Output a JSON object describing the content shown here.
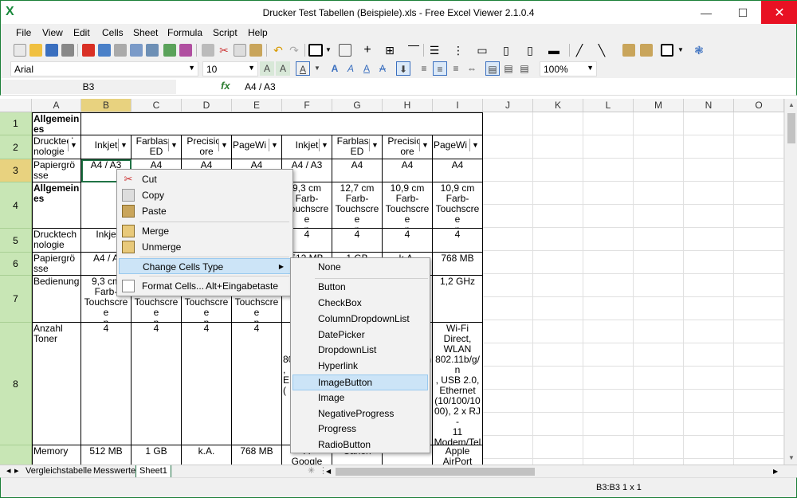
{
  "window": {
    "title": "Drucker Test Tabellen (Beispiele).xls - Free Excel Viewer 2.1.0.4",
    "app_icon": "X",
    "minimize": "—",
    "maximize": "☐",
    "close": "✕"
  },
  "menu": [
    "File",
    "View",
    "Edit",
    "Cells",
    "Sheet",
    "Formula",
    "Script",
    "Help"
  ],
  "toolbar": {
    "font": "Arial",
    "size": "10",
    "zoom": "100%"
  },
  "formula": {
    "name_box": "B3",
    "fx": "fx",
    "value": "A4 / A3"
  },
  "columns": [
    "A",
    "B",
    "C",
    "D",
    "E",
    "F",
    "G",
    "H",
    "I",
    "J",
    "K",
    "L",
    "M",
    "N",
    "O"
  ],
  "rows": [
    "1",
    "2",
    "3",
    "4",
    "5",
    "6",
    "7",
    "8",
    ""
  ],
  "cells": {
    "r1": {
      "a": "Allgemeines"
    },
    "r2": {
      "a": "Drucktechnologie",
      "b": "Inkjet",
      "c": "Farblaser\nED",
      "d": "Precision\nore",
      "e": "PageWi",
      "f": "Inkjet",
      "g": "Farblaser\nED",
      "h": "Precision\nore",
      "i": "PageWi"
    },
    "r3": {
      "a": "Papiergrösse",
      "b": "A4 / A3",
      "c": "A4",
      "d": "A4",
      "e": "A4",
      "f": "A4 / A3",
      "g": "A4",
      "h": "A4",
      "i": "A4"
    },
    "r4": {
      "a": "Allgemeines",
      "f": "9,3 cm\nFarb-\nTouchscree\nn",
      "g": "12,7 cm\nFarb-\nTouchscree\nn",
      "h": "10,9 cm\nFarb-\nTouchscree\nn",
      "i": "10,9 cm\nFarb-\nTouchscree\nn"
    },
    "r5": {
      "a": "Drucktechnologie",
      "b": "Inkje",
      "f": "4",
      "g": "4",
      "h": "4",
      "i": "4"
    },
    "r6": {
      "a": "Papiergrösse",
      "b": "A4 / A",
      "f": "512 MB",
      "g": "1 GB",
      "h": "k.A.",
      "i": "768 MB"
    },
    "r7": {
      "a": "Bedienung",
      "b": "9,3 cm\nFarb-\nTouchscree\nn",
      "c": "Farb-\nTouchscree\nn",
      "d": "Farb-\nTouchscree\nn",
      "e": "Farb-\nTouchscree\nn",
      "i": "1,2 GHz"
    },
    "r8": {
      "a": "Anzahl\nToner",
      "b": "4",
      "c": "4",
      "d": "4",
      "e": "4",
      "f": "80\n,\nE\n(",
      "h": "n",
      "i": "Wi-Fi\nDirect,\nWLAN\n802.11b/g/n\n, USB 2.0,\nEthernet\n(10/100/10\n00), 2 x RJ-\n11\nModem/Tel\nefon"
    },
    "r9": {
      "a": "Memory",
      "b": "512 MB",
      "c": "1 GB",
      "d": "k.A.",
      "e": "768 MB",
      "f": "A\nGoogle",
      "g": "Canon",
      "h": "",
      "i": "Apple\nAirPort"
    }
  },
  "context_menu": {
    "cut": "Cut",
    "copy": "Copy",
    "paste": "Paste",
    "merge": "Merge",
    "unmerge": "Unmerge",
    "change_type": "Change Cells Type",
    "format_cells": "Format Cells...",
    "format_shortcut": "Alt+Eingabetaste"
  },
  "submenu": [
    "None",
    "Button",
    "CheckBox",
    "ColumnDropdownList",
    "DatePicker",
    "DropdownList",
    "Hyperlink",
    "ImageButton",
    "Image",
    "NegativeProgress",
    "Progress",
    "RadioButton"
  ],
  "sheets": [
    "Vergleichstabelle",
    "Messwerte",
    "Sheet1"
  ],
  "status": "B3:B3 1 x 1",
  "colors": {
    "accent": "#217346",
    "row_header": "#c8e6b5",
    "selected_header": "#e8d27f",
    "menu_highlight": "#cce4f7",
    "close": "#e81123"
  }
}
